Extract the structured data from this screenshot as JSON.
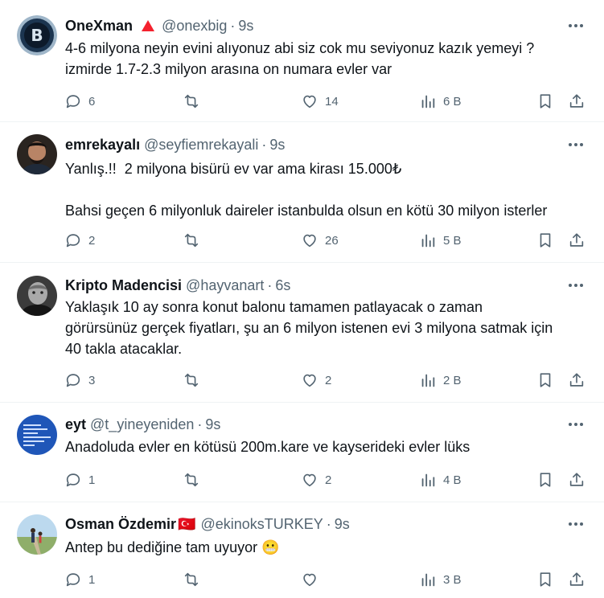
{
  "tweets": [
    {
      "name": "OneXman",
      "handle": "@onexbig",
      "sep": "·",
      "time": "9s",
      "text": "4-6 milyona neyin evini alıyonuz abi siz cok mu seviyonuz kazık yemeyi ?\nizmirde 1.7-2.3 milyon arasına on numara evler var",
      "replies": "6",
      "retweets": "",
      "likes": "14",
      "views": "6 B"
    },
    {
      "name": "emrekayalı",
      "handle": "@seyfiemrekayali",
      "sep": "·",
      "time": "9s",
      "text": "Yanlış.!!  2 milyona bisürü ev var ama kirası 15.000₺\n\nBahsi geçen 6 milyonluk daireler istanbulda olsun en kötü 30 milyon isterler",
      "replies": "2",
      "retweets": "",
      "likes": "26",
      "views": "5 B"
    },
    {
      "name": "Kripto Madencisi",
      "handle": "@hayvanart",
      "sep": "·",
      "time": "6s",
      "text": "Yaklaşık 10 ay sonra konut balonu tamamen patlayacak o zaman\ngörürsünüz gerçek fiyatları, şu an 6 milyon istenen evi 3 milyona satmak için\n40 takla atacaklar.",
      "replies": "3",
      "retweets": "",
      "likes": "2",
      "views": "2 B"
    },
    {
      "name": "eyt",
      "handle": "@t_yineyeniden",
      "sep": "·",
      "time": "9s",
      "text": "Anadoluda evler en kötüsü 200m.kare ve kayserideki evler lüks",
      "replies": "1",
      "retweets": "",
      "likes": "2",
      "views": "4 B"
    },
    {
      "name": "Osman Özdemir",
      "flag": "🇹🇷",
      "handle": "@ekinoksTURKEY",
      "sep": "·",
      "time": "9s",
      "text": "Antep bu dediğine tam uyuyor 😬",
      "replies": "1",
      "retweets": "",
      "likes": "",
      "views": "3 B"
    }
  ],
  "colors": {
    "text": "#0f1419",
    "muted": "#536471",
    "divider": "#eff3f4",
    "badge": "#f4212e"
  }
}
